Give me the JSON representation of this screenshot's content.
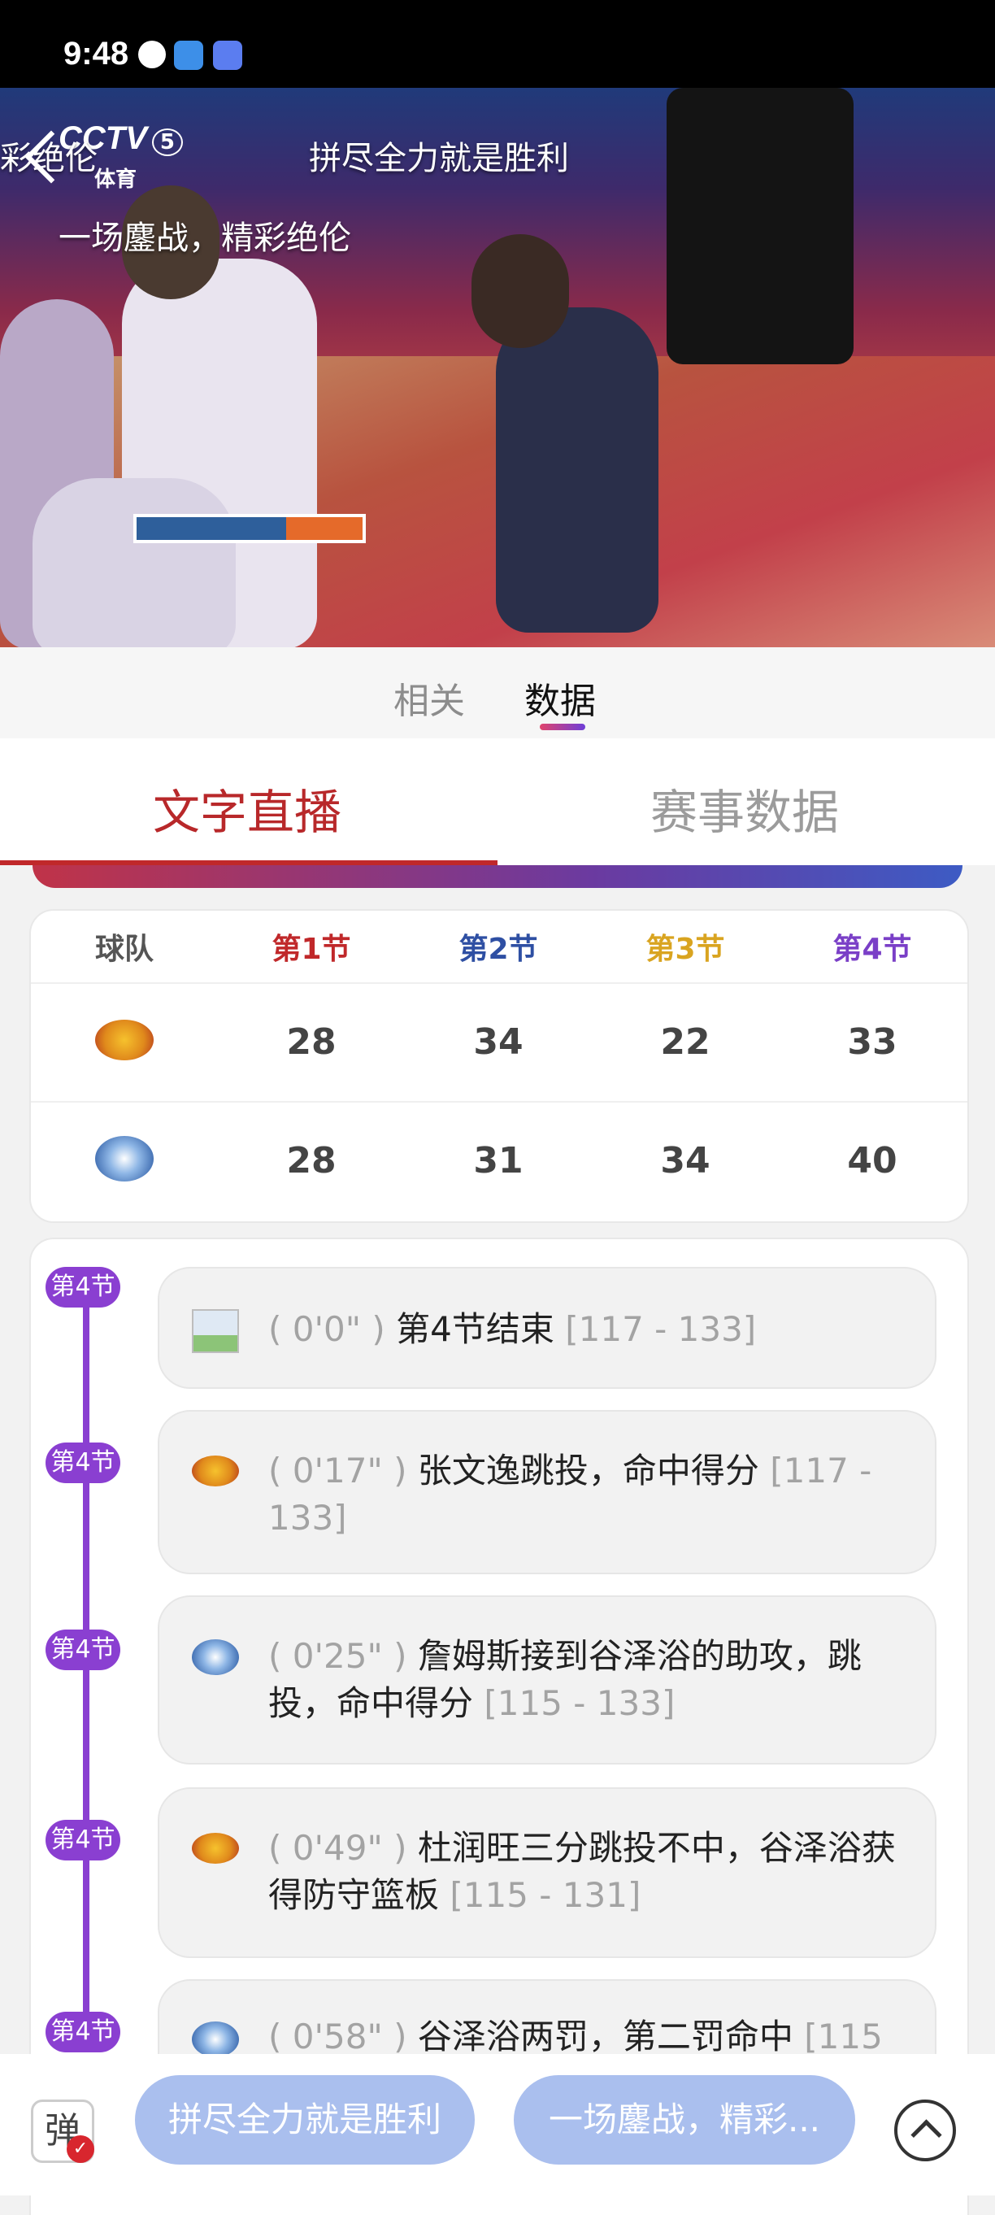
{
  "status_bar": {
    "time": "9:48"
  },
  "video": {
    "channel_logo": "CCTV",
    "channel_num": "5",
    "channel_sub": "体育",
    "danmaku": [
      "拼尽全力就是胜利",
      "一场鏖战，精彩绝伦",
      "彩绝伦"
    ]
  },
  "top_tabs": {
    "related": "相关",
    "data": "数据",
    "active": "data"
  },
  "sub_tabs": {
    "live_text": "文字直播",
    "match_stats": "赛事数据",
    "active": "live_text"
  },
  "score_table": {
    "headers": [
      "球队",
      "第1节",
      "第2节",
      "第3节",
      "第4节"
    ],
    "header_colors": [
      "#555555",
      "#c0282a",
      "#2e4fa3",
      "#d9a420",
      "#7a3fc7"
    ],
    "teams": [
      {
        "logo": "tiger-logo",
        "scores": [
          "28",
          "34",
          "22",
          "33"
        ]
      },
      {
        "logo": "pioneers-logo",
        "scores": [
          "28",
          "31",
          "34",
          "40"
        ]
      }
    ]
  },
  "events": [
    {
      "quarter": "第4节",
      "icon": "broken-image-icon",
      "time": "( 0'0\" )",
      "desc": "第4节结束",
      "score": "[117 - 133]"
    },
    {
      "quarter": "第4节",
      "icon": "tiger-logo",
      "time": "( 0'17\" )",
      "desc": "张文逸跳投，命中得分",
      "score": "[117 - 133]"
    },
    {
      "quarter": "第4节",
      "icon": "pioneers-logo",
      "time": "( 0'25\" )",
      "desc": "詹姆斯接到谷泽浴的助攻，跳投，命中得分",
      "score": "[115 - 133]"
    },
    {
      "quarter": "第4节",
      "icon": "tiger-logo",
      "time": "( 0'49\" )",
      "desc": "杜润旺三分跳投不中，谷泽浴获得防守篮板",
      "score": "[115 - 131]"
    },
    {
      "quarter": "第4节",
      "icon": "pioneers-logo",
      "time": "( 0'58\" )",
      "desc": "谷泽浴两罚，第二罚命中",
      "score": "[115"
    }
  ],
  "bottom_bar": {
    "danmaku_toggle": "弹",
    "chip1": "拼尽全力就是胜利",
    "chip2": "一场鏖战，精彩..."
  }
}
